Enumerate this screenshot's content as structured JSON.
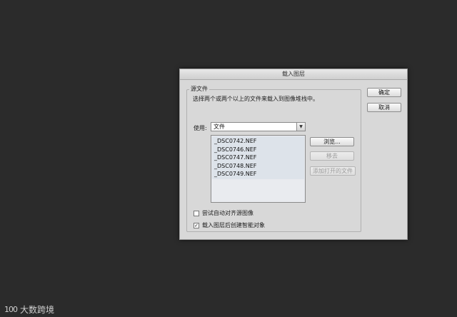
{
  "dialog": {
    "title": "载入图层",
    "group_label": "源文件",
    "description": "选择两个或两个以上的文件来载入到图像堆栈中。",
    "use_label": "使用:",
    "use_value": "文件",
    "files": [
      "_DSC0742.NEF",
      "_DSC0746.NEF",
      "_DSC0747.NEF",
      "_DSC0748.NEF",
      "_DSC0749.NEF"
    ],
    "buttons": {
      "ok": "确定",
      "cancel": "取消",
      "browse": "浏览...",
      "remove": "移去",
      "add_open": "添加打开的文件"
    },
    "options": {
      "auto_align": {
        "label": "尝试自动对齐源图像",
        "checked": false
      },
      "smart_object": {
        "label": "载入图层后创建智能对象",
        "checked": true
      }
    }
  },
  "watermark": {
    "logo_text": "100",
    "brand": "大数跨境"
  }
}
